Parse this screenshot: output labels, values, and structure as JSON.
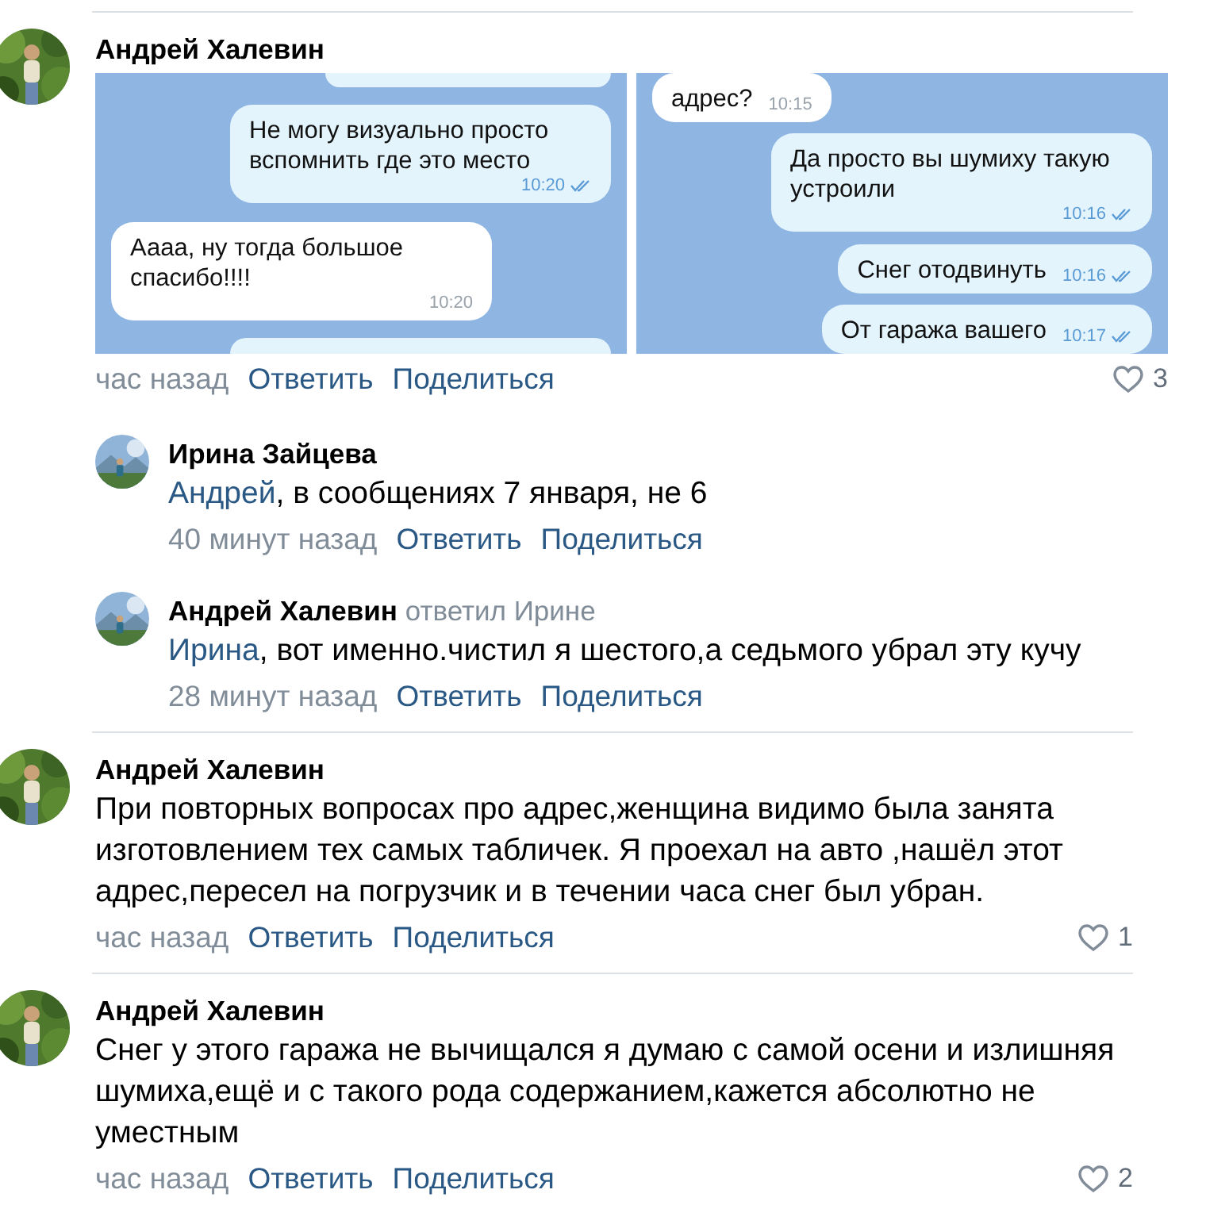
{
  "comments": [
    {
      "author": "Андрей Халевин",
      "attachments": [
        {
          "kind": "chat",
          "messages": [
            {
              "kind": "cut-top",
              "outgoing": true
            },
            {
              "kind": "message",
              "outgoing": true,
              "text": "Не могу визуально просто вспомнить где это место",
              "time": "10:20"
            },
            {
              "kind": "message",
              "outgoing": false,
              "text": "Аааа, ну тогда большое спасибо!!!!",
              "time": "10:20"
            },
            {
              "kind": "cut-bottom",
              "outgoing": true
            }
          ]
        },
        {
          "kind": "chat",
          "messages": [
            {
              "kind": "message",
              "outgoing": false,
              "text": "адрес?",
              "time": "10:15"
            },
            {
              "kind": "message",
              "outgoing": true,
              "text": "Да просто вы шумиху такую устроили",
              "time": "10:16"
            },
            {
              "kind": "message",
              "outgoing": true,
              "text": "Снег отодвинуть",
              "time": "10:16"
            },
            {
              "kind": "message",
              "outgoing": true,
              "text": "От гаража вашего",
              "time": "10:17"
            }
          ]
        }
      ],
      "time": "час назад",
      "actions": [
        "Ответить",
        "Поделиться"
      ],
      "likes": "3",
      "replies": [
        {
          "author": "Ирина Зайцева",
          "mention": "Андрей",
          "text": ", в сообщениях 7 января, не 6",
          "time": "40 минут назад",
          "actions": [
            "Ответить",
            "Поделиться"
          ]
        },
        {
          "author": "Андрей Халевин",
          "replied_to": "ответил Ирине",
          "mention": "Ирина",
          "text": ", вот именно.чистил я шестого,а седьмого убрал эту кучу",
          "time": "28 минут назад",
          "actions": [
            "Ответить",
            "Поделиться"
          ]
        }
      ]
    },
    {
      "author": "Андрей Халевин",
      "text": "При повторных вопросах про адрес,женщина видимо была занята изготовлением тех самых табличек. Я проехал на авто ,нашёл этот адрес,пересел на погрузчик и в течении часа снег был убран.",
      "time": "час назад",
      "actions": [
        "Ответить",
        "Поделиться"
      ],
      "likes": "1"
    },
    {
      "author": "Андрей Халевин",
      "text": "Снег у этого гаража не вычищался я думаю с самой осени и излишняя шумиха,ещё и с такого рода содержанием,кажется абсолютно не уместным",
      "time": "час назад",
      "actions": [
        "Ответить",
        "Поделиться"
      ],
      "likes": "2"
    }
  ]
}
